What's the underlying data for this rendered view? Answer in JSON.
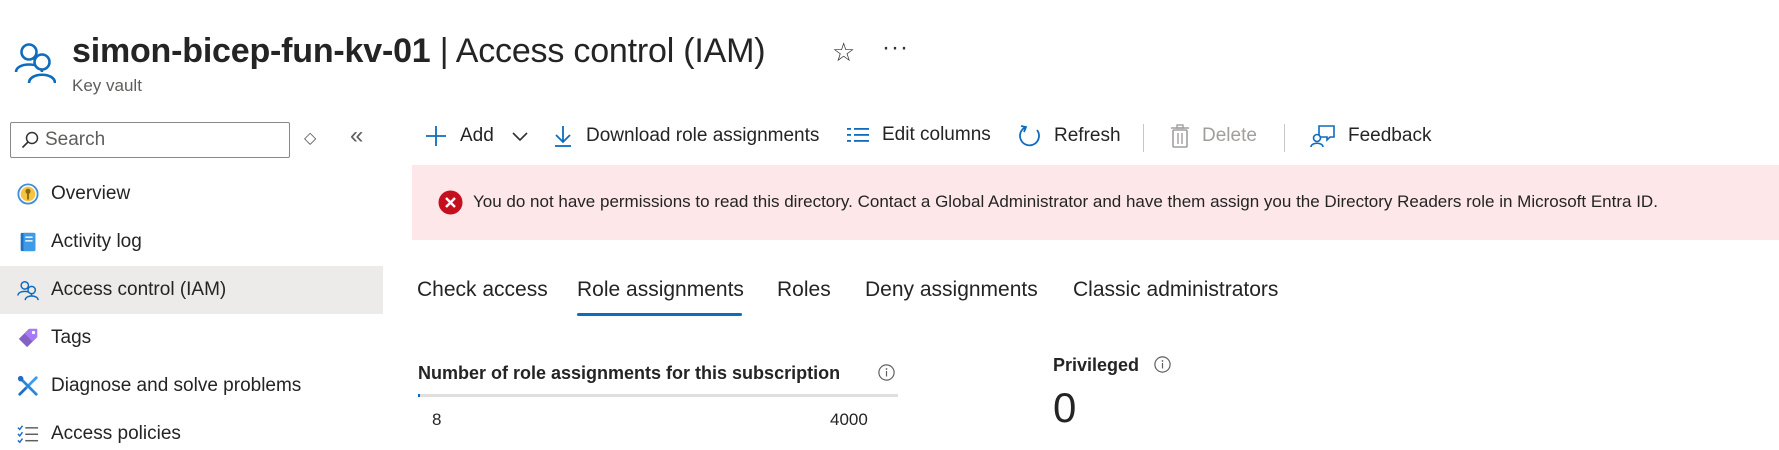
{
  "header": {
    "resource_name": "simon-bicep-fun-kv-01",
    "separator": " | ",
    "page_name": "Access control (IAM)",
    "subtitle": "Key vault",
    "icon": "users-icon",
    "favorite_icon": "star-icon",
    "more_label": "···"
  },
  "sidebar": {
    "search_placeholder": "Search",
    "items": [
      {
        "label": "Overview",
        "icon": "key-vault-icon",
        "active": false
      },
      {
        "label": "Activity log",
        "icon": "activity-log-icon",
        "active": false
      },
      {
        "label": "Access control (IAM)",
        "icon": "users-icon",
        "active": true
      },
      {
        "label": "Tags",
        "icon": "tag-icon",
        "active": false
      },
      {
        "label": "Diagnose and solve problems",
        "icon": "wrench-icon",
        "active": false
      },
      {
        "label": "Access policies",
        "icon": "list-check-icon",
        "active": false
      }
    ]
  },
  "toolbar": {
    "add_label": "Add",
    "download_label": "Download role assignments",
    "edit_columns_label": "Edit columns",
    "refresh_label": "Refresh",
    "delete_label": "Delete",
    "feedback_label": "Feedback"
  },
  "banner": {
    "message": "You do not have permissions to read this directory. Contact a Global Administrator and have them assign you the Directory Readers role in Microsoft Entra ID.",
    "icon": "error-circle-icon",
    "color": "#c50f1f",
    "background": "#fde7e9"
  },
  "tabs": [
    {
      "label": "Check access",
      "active": false
    },
    {
      "label": "Role assignments",
      "active": true
    },
    {
      "label": "Roles",
      "active": false
    },
    {
      "label": "Deny assignments",
      "active": false
    },
    {
      "label": "Classic administrators",
      "active": false
    }
  ],
  "stats": {
    "role_assignments_title": "Number of role assignments for this subscription",
    "role_assignments_current": "8",
    "role_assignments_max": "4000",
    "role_assignments_fraction": 0.002,
    "privileged_title": "Privileged",
    "privileged_value": "0"
  },
  "colors": {
    "accent": "#0f6cbd",
    "nav_active_bg": "#edebe9"
  }
}
